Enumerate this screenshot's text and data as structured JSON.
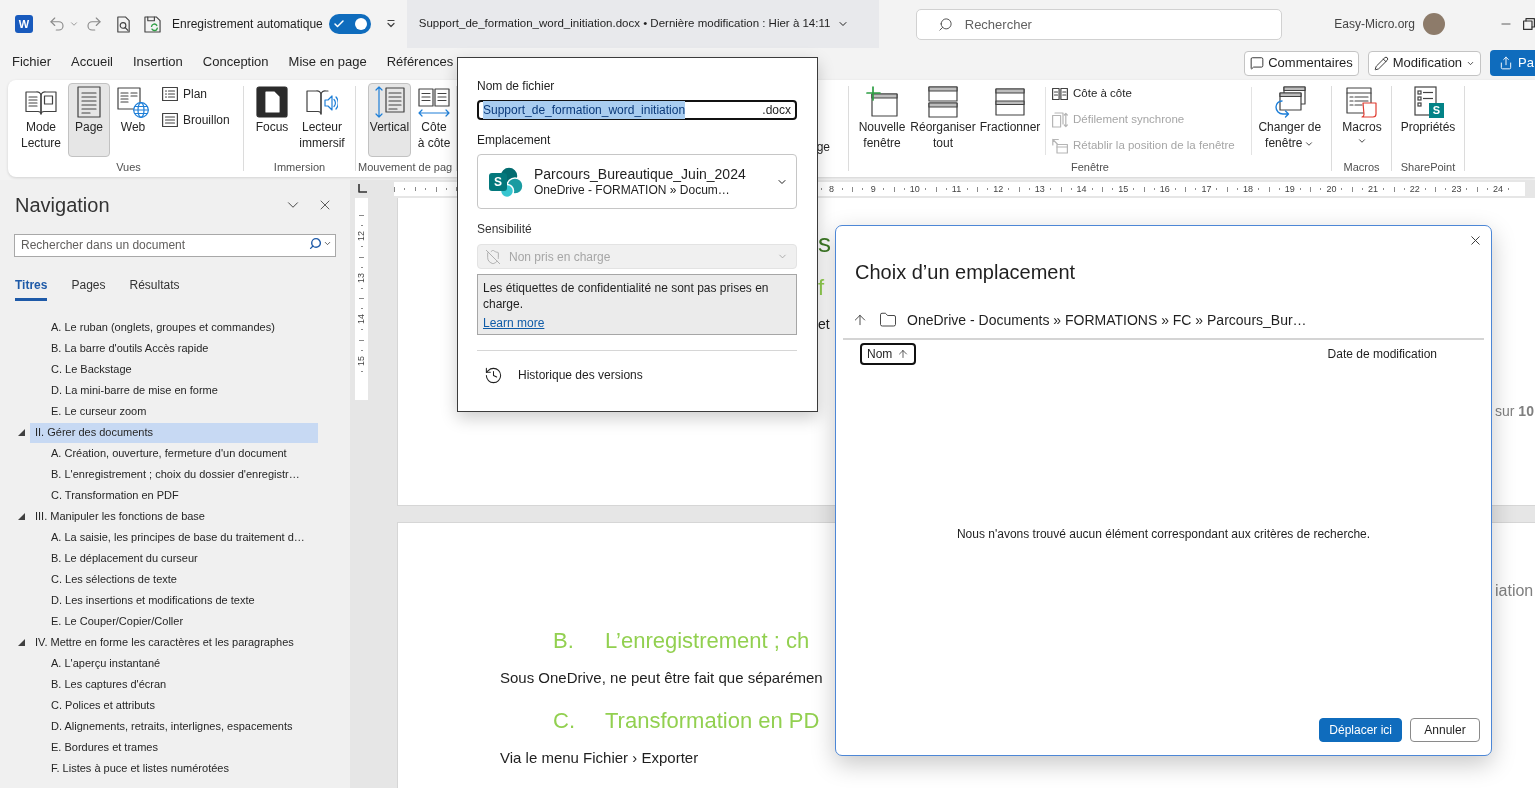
{
  "title_bar": {
    "app_logo": "W",
    "autosave": {
      "label": "Enregistrement automatique",
      "on": true
    },
    "document_title": "Support_de_formation_word_initiation.docx • Dernière modification : Hier à 14:11",
    "search": {
      "placeholder": "Rechercher"
    },
    "account": "Easy-Micro.org"
  },
  "ribbon_tabs": [
    {
      "label": "Fichier",
      "selected": false
    },
    {
      "label": "Accueil",
      "selected": false
    },
    {
      "label": "Insertion",
      "selected": false
    },
    {
      "label": "Conception",
      "selected": false
    },
    {
      "label": "Mise en page",
      "selected": false
    },
    {
      "label": "Références",
      "selected": false
    }
  ],
  "ribbon_actions": [
    {
      "kind": "comments",
      "label": "Commentaires"
    },
    {
      "kind": "editing",
      "label": "Modification"
    },
    {
      "kind": "share",
      "label": "Pa"
    }
  ],
  "ribbon": {
    "groups": [
      {
        "kind": "group",
        "label": "Vues",
        "items": [
          {
            "kind": "large",
            "label": "Mode\nLecture",
            "selected": false
          },
          {
            "kind": "large",
            "label": "Page",
            "selected": true
          },
          {
            "kind": "large",
            "label": "Web",
            "selected": false
          },
          {
            "kind": "stack",
            "items": [
              {
                "label": "Plan",
                "selected": false
              },
              {
                "label": "Brouillon",
                "selected": false
              }
            ]
          }
        ]
      },
      {
        "kind": "group",
        "label": "Immersion",
        "items": [
          {
            "kind": "large",
            "label": "Focus"
          },
          {
            "kind": "large",
            "label": "Lecteur\nimmersif"
          }
        ]
      },
      {
        "kind": "group",
        "label": "Mouvement de pag",
        "items": [
          {
            "kind": "large",
            "label": "Vertical",
            "selected": true
          },
          {
            "kind": "large",
            "label": "Côte\nà côte",
            "selected": false
          }
        ]
      },
      {
        "kind": "covered",
        "text": "ge"
      },
      {
        "kind": "group",
        "label": "Fenêtre",
        "items": [
          {
            "kind": "large",
            "label": "Nouvelle\nfenêtre"
          },
          {
            "kind": "large",
            "label": "Réorganiser\ntout"
          },
          {
            "kind": "large",
            "label": "Fractionner"
          },
          {
            "kind": "stack",
            "items": [
              {
                "label": "Côte à côte",
                "disabled": false
              },
              {
                "label": "Défilement synchrone",
                "disabled": true
              },
              {
                "label": "Rétablir la position de la fenêtre",
                "disabled": true
              }
            ]
          },
          {
            "kind": "large",
            "label": "Changer de\nfenêtre",
            "has_menu": true
          }
        ]
      },
      {
        "kind": "group",
        "label": "Macros",
        "items": [
          {
            "kind": "large",
            "label": "Macros",
            "has_menu": true
          }
        ]
      },
      {
        "kind": "group",
        "label": "SharePoint",
        "items": [
          {
            "kind": "large",
            "label": "Propriétés",
            "badge": "S"
          }
        ]
      }
    ]
  },
  "file_popup": {
    "file_name": {
      "label": "Nom de fichier",
      "value": "Support_de_formation_word_initiation",
      "value_selected": true,
      "extension": ".docx"
    },
    "location": {
      "label": "Emplacement",
      "icon_letter": "S",
      "name": "Parcours_Bureautique_Juin_2024",
      "path": "OneDrive - FORMATION » Docum…"
    },
    "sensitivity": {
      "label": "Sensibilité",
      "value": "Non pris en charge",
      "disabled": true
    },
    "notice": {
      "text": "Les étiquettes de confidentialité ne sont pas prises en charge.",
      "link": "Learn more"
    },
    "version_history": "Historique des versions"
  },
  "navigation": {
    "title": "Navigation",
    "search": {
      "placeholder": "Rechercher dans un document"
    },
    "tabs": [
      {
        "label": "Titres",
        "selected": true
      },
      {
        "label": "Pages",
        "selected": false
      },
      {
        "label": "Résultats",
        "selected": false
      }
    ],
    "headings": [
      {
        "children": [
          {
            "label": "A. Le ruban (onglets, groupes et commandes)",
            "selected": false
          },
          {
            "label": "B. La barre d'outils Accès rapide",
            "selected": false
          },
          {
            "label": "C. Le Backstage",
            "selected": false
          },
          {
            "label": "D. La mini-barre de mise en forme",
            "selected": false
          },
          {
            "label": "E. Le curseur zoom",
            "selected": false
          }
        ]
      },
      {
        "label": "II. Gérer des documents",
        "expanded": true,
        "selected": true,
        "children": [
          {
            "label": "A. Création, ouverture, fermeture d'un document",
            "selected": false
          },
          {
            "label": "B. L'enregistrement ; choix du dossier d'enregistr…",
            "selected": false
          },
          {
            "label": "C. Transformation en PDF",
            "selected": false
          }
        ]
      },
      {
        "label": "III. Manipuler les fonctions de base",
        "expanded": true,
        "selected": false,
        "children": [
          {
            "label": "A. La saisie, les principes de base du traitement d…",
            "selected": false
          },
          {
            "label": "B. Le déplacement du curseur",
            "selected": false
          },
          {
            "label": "C. Les sélections de texte",
            "selected": false
          },
          {
            "label": "D. Les insertions et modifications de texte",
            "selected": false
          },
          {
            "label": "E. Le Couper/Copier/Coller",
            "selected": false
          }
        ]
      },
      {
        "label": "IV. Mettre en forme les caractères et les paragraphes",
        "expanded": true,
        "selected": false,
        "children": [
          {
            "label": "A. L'aperçu instantané",
            "selected": false
          },
          {
            "label": "B. Les captures d'écran",
            "selected": false
          },
          {
            "label": "C. Polices et attributs",
            "selected": false
          },
          {
            "label": "D. Alignements, retraits, interlignes, espacements",
            "selected": false
          },
          {
            "label": "E. Bordures et trames",
            "selected": false
          },
          {
            "label": "F. Listes à puce et listes numérotées",
            "selected": false
          }
        ]
      }
    ]
  },
  "horizontal_ruler": {
    "numbers": [
      "8",
      "9",
      "10",
      "11",
      "12",
      "13",
      "14",
      "15",
      "16",
      "17",
      "18",
      "19",
      "20",
      "21",
      "22",
      "23",
      "24"
    ]
  },
  "vertical_ruler": {
    "numbers": [
      "12",
      "13",
      "14",
      "15"
    ]
  },
  "document": {
    "pages": [
      {
        "fragments": [
          {
            "kind": "heading_dark",
            "text": "s"
          },
          {
            "kind": "heading_light",
            "text": "f"
          },
          {
            "kind": "body",
            "text": "et"
          }
        ],
        "margin_text": "sur **10**"
      },
      {
        "blocks": [
          {
            "kind": "heading",
            "number": "B.",
            "text": "L’enregistrement ; ch"
          },
          {
            "kind": "paragraph",
            "text": "Sous OneDrive, ne peut être fait que séparémen"
          },
          {
            "kind": "heading",
            "number": "C.",
            "text": "Transformation en PD"
          },
          {
            "kind": "paragraph",
            "text": "Via le menu Fichier › Exporter"
          }
        ],
        "margin_text": "iation"
      }
    ]
  },
  "location_dialog": {
    "title": "Choix d’un emplacement",
    "breadcrumb": "OneDrive - Documents » FORMATIONS » FC » Parcours_Bur…",
    "columns": [
      {
        "label": "Nom",
        "sorted": true,
        "focused": true
      },
      {
        "label": "Date de modification",
        "sorted": false,
        "focused": false
      }
    ],
    "empty_message": "Nous n'avons trouvé aucun élément correspondant aux critères de recherche.",
    "buttons": [
      {
        "kind": "primary",
        "label": "Déplacer ici"
      },
      {
        "kind": "secondary",
        "label": "Annuler"
      }
    ]
  }
}
